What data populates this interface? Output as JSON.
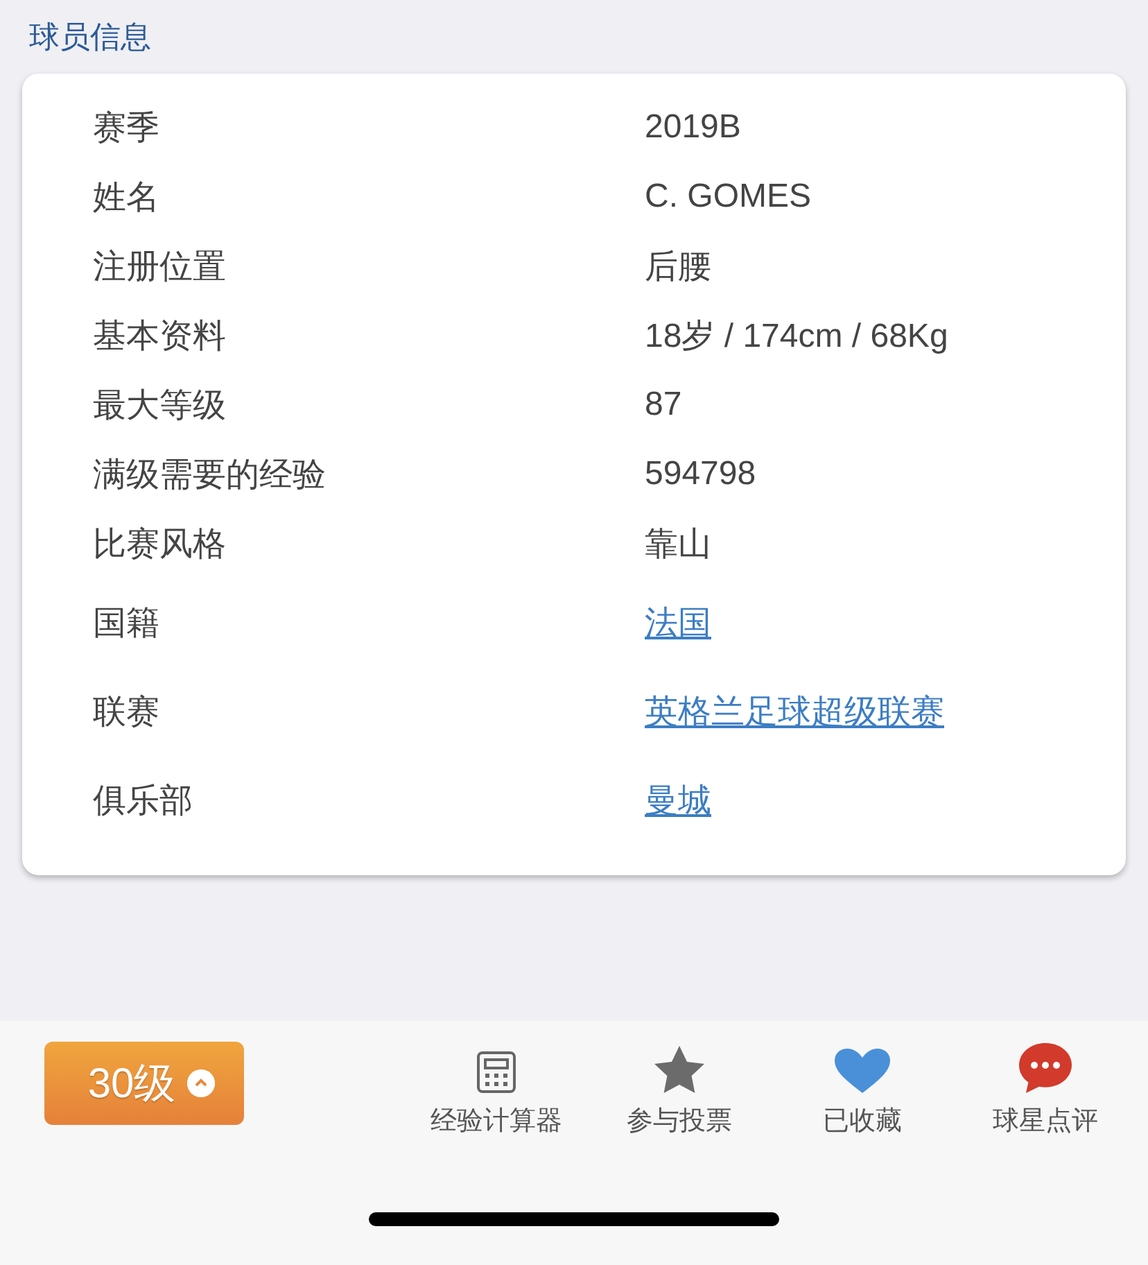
{
  "section_title": "球员信息",
  "rows": [
    {
      "label": "赛季",
      "value": "2019B",
      "kind": "text"
    },
    {
      "label": "姓名",
      "value": "C. GOMES",
      "kind": "text"
    },
    {
      "label": "注册位置",
      "value": "后腰",
      "kind": "text"
    },
    {
      "label": "基本资料",
      "value": "18岁 / 174cm / 68Kg",
      "kind": "text"
    },
    {
      "label": "最大等级",
      "value": "87",
      "kind": "text"
    },
    {
      "label": "满级需要的经验",
      "value": "594798",
      "kind": "text"
    },
    {
      "label": "比赛风格",
      "value": "靠山",
      "kind": "text"
    },
    {
      "label": "国籍",
      "value": "法国",
      "kind": "link"
    },
    {
      "label": "联赛",
      "value": "英格兰足球超级联赛",
      "kind": "link"
    },
    {
      "label": "俱乐部",
      "value": "曼城",
      "kind": "link"
    }
  ],
  "level_button": {
    "label": "30级"
  },
  "actions": [
    {
      "label": "经验计算器",
      "kind": "calculator"
    },
    {
      "label": "参与投票",
      "kind": "star"
    },
    {
      "label": "已收藏",
      "kind": "heart"
    },
    {
      "label": "球星点评",
      "kind": "comment"
    }
  ]
}
